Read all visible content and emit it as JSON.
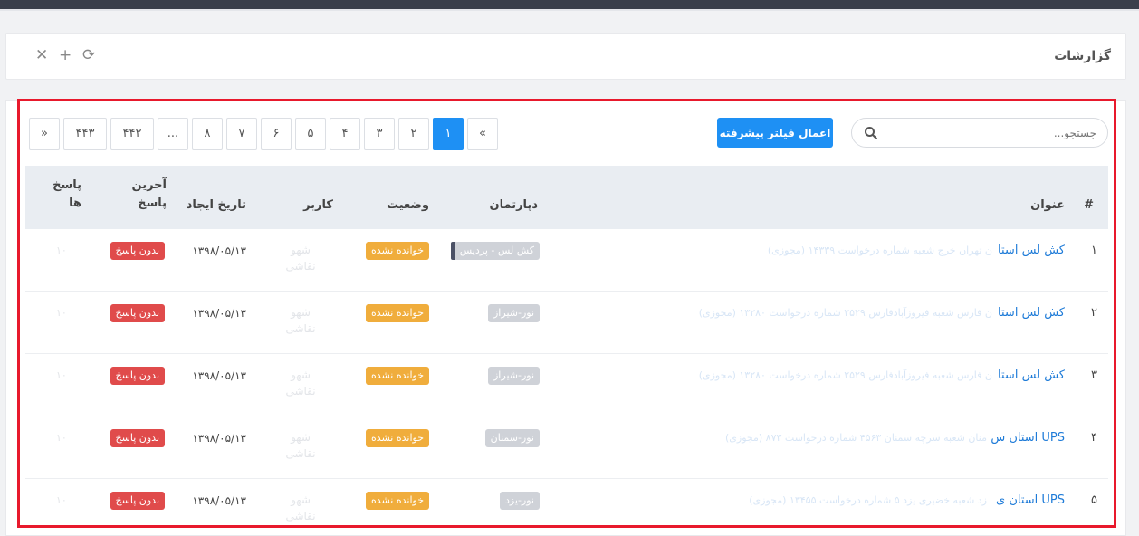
{
  "header": {
    "title": "گزارشات",
    "tools": [
      {
        "name": "refresh-icon",
        "glyph": "⟳"
      },
      {
        "name": "add-icon",
        "glyph": "+"
      },
      {
        "name": "close-icon",
        "glyph": "✕"
      }
    ]
  },
  "toolbar": {
    "search_placeholder": "جستجو...",
    "filter_label": "اعمال فیلتر پیشرفته",
    "pages": [
      "»",
      "۴۴۳",
      "۴۴۲",
      "...",
      "۸",
      "۷",
      "۶",
      "۵",
      "۴",
      "۳",
      "۲",
      "۱",
      "«"
    ],
    "active_page": "۱"
  },
  "table": {
    "headers": {
      "index": "#",
      "title": "عنوان",
      "department": "دپارتمان",
      "status": "وضعیت",
      "user": "کاربر",
      "created": "تاریخ ایجاد",
      "last_reply": "آخرین پاسخ",
      "replies": "پاسخ ها"
    },
    "rows": [
      {
        "index": "۱",
        "title": "کش لس استا",
        "title_faded": "ن تهران خرج شعبه شماره درخواست ۱۴۳۳۹ (مجوزی)",
        "department": "کش لس - پردیس",
        "status": "خوانده نشده",
        "user": "شهو نقاشی",
        "created": "۱۳۹۸/۰۵/۱۳",
        "last_reply": "بدون پاسخ",
        "replies": "۱۰"
      },
      {
        "index": "۲",
        "title": "کش لس استا",
        "title_faded": "ن فارس شعبه فیروزآبادفارس ۲۵۲۹ شماره درخواست ۱۳۲۸۰ (مجوزی)",
        "department": "نور-شیراز",
        "status": "خوانده نشده",
        "user": "شهو نقاشی",
        "created": "۱۳۹۸/۰۵/۱۳",
        "last_reply": "بدون پاسخ",
        "replies": "۱۰"
      },
      {
        "index": "۳",
        "title": "کش لس استا",
        "title_faded": "ن فارس شعبه فیروزآبادفارس ۲۵۲۹ شماره درخواست ۱۳۲۸۰ (مجوزی)",
        "department": "نور-شیراز",
        "status": "خوانده نشده",
        "user": "شهو نقاشی",
        "created": "۱۳۹۸/۰۵/۱۳",
        "last_reply": "بدون پاسخ",
        "replies": "۱۰"
      },
      {
        "index": "۴",
        "title": "UPS استان س",
        "title_faded": "منان شعبه سرچه سمنان ۴۵۶۳ شماره درخواست ۸۷۳ (مجوزی)",
        "department": "نور-سمنان",
        "status": "خوانده نشده",
        "user": "شهو نقاشی",
        "created": "۱۳۹۸/۰۵/۱۳",
        "last_reply": "بدون پاسخ",
        "replies": "۱۰"
      },
      {
        "index": "۵",
        "title": "UPS استان ی",
        "title_faded": "زد شعبه خضیری یزد ۵ شماره درخواست ۱۳۴۵۵ (مجوزی)",
        "department": "نور-یزد",
        "status": "خوانده نشده",
        "user": "شهو نقاشی",
        "created": "۱۳۹۸/۰۵/۱۳",
        "last_reply": "بدون پاسخ",
        "replies": "۱۰"
      }
    ]
  },
  "colors": {
    "accent": "#1e90f4",
    "status_unread": "#f0ad3c",
    "no_reply": "#e04b4b",
    "highlight": "#e8192c"
  }
}
